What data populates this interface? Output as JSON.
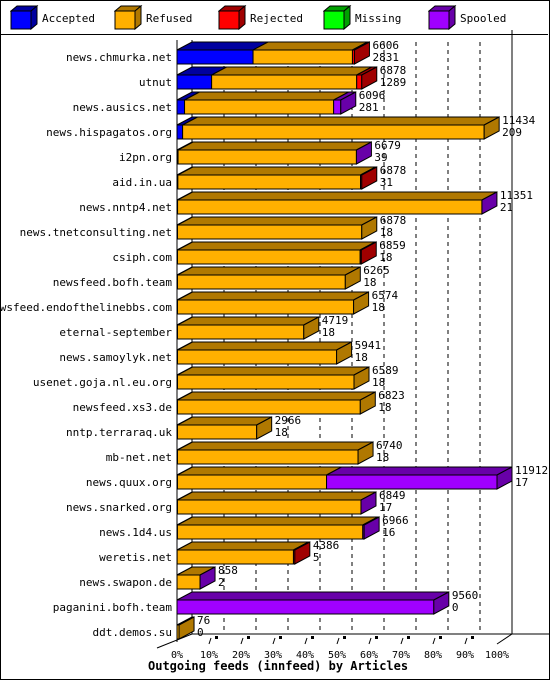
{
  "chart_data": {
    "type": "bar",
    "orientation": "horizontal",
    "stacked": true,
    "title": "Outgoing feeds (innfeed) by Articles",
    "xlabel": "Outgoing feeds (innfeed) by Articles",
    "ylabel": "",
    "x_ticks": [
      "0%",
      "10%",
      "20%",
      "30%",
      "40%",
      "50%",
      "60%",
      "70%",
      "80%",
      "90%",
      "100%"
    ],
    "xlim": [
      0,
      11912
    ],
    "grid": true,
    "legend_position": "top",
    "legend": [
      {
        "name": "Accepted",
        "color": "#0000ff",
        "side": "#0000a0"
      },
      {
        "name": "Refused",
        "color": "#ffb000",
        "side": "#b07800"
      },
      {
        "name": "Rejected",
        "color": "#ff0000",
        "side": "#a00000"
      },
      {
        "name": "Missing",
        "color": "#00ff00",
        "side": "#00a000"
      },
      {
        "name": "Spooled",
        "color": "#a000ff",
        "side": "#6800a8"
      }
    ],
    "categories": [
      "news.chmurka.net",
      "utnut",
      "news.ausics.net",
      "news.hispagatos.org",
      "i2pn.org",
      "aid.in.ua",
      "news.nntp4.net",
      "news.tnetconsulting.net",
      "csiph.com",
      "newsfeed.bofh.team",
      "newsfeed.endofthelinebbs.com",
      "eternal-september",
      "news.samoylyk.net",
      "usenet.goja.nl.eu.org",
      "newsfeed.xs3.de",
      "nntp.terraraq.uk",
      "mb-net.net",
      "news.quux.org",
      "news.snarked.org",
      "news.1d4.us",
      "weretis.net",
      "news.swapon.de",
      "paganini.bofh.team",
      "ddt.demos.su"
    ],
    "totals": [
      6606,
      6878,
      6096,
      11434,
      6679,
      6878,
      11351,
      6878,
      6859,
      6265,
      6574,
      4719,
      5941,
      6589,
      6823,
      2966,
      6740,
      11912,
      6849,
      6966,
      4386,
      858,
      9560,
      76
    ],
    "accepted_labels": [
      2831,
      1289,
      281,
      209,
      39,
      31,
      21,
      18,
      18,
      18,
      18,
      18,
      18,
      18,
      18,
      18,
      18,
      17,
      17,
      16,
      5,
      2,
      0,
      0
    ],
    "series": [
      {
        "name": "Accepted",
        "values": [
          2831,
          1289,
          281,
          209,
          39,
          31,
          21,
          18,
          18,
          18,
          18,
          18,
          18,
          18,
          18,
          18,
          18,
          17,
          17,
          16,
          5,
          2,
          0,
          0
        ]
      },
      {
        "name": "Refused",
        "values": [
          3700,
          5400,
          5550,
          11225,
          6640,
          6800,
          11330,
          6860,
          6800,
          6247,
          6556,
          4701,
          5923,
          6571,
          6805,
          2948,
          6722,
          5550,
          6832,
          6900,
          4330,
          856,
          0,
          76
        ]
      },
      {
        "name": "Rejected",
        "values": [
          75,
          189,
          0,
          0,
          0,
          47,
          0,
          0,
          41,
          0,
          0,
          0,
          0,
          0,
          0,
          0,
          0,
          0,
          0,
          0,
          51,
          0,
          0,
          0
        ]
      },
      {
        "name": "Missing",
        "values": [
          0,
          0,
          0,
          0,
          0,
          0,
          0,
          0,
          0,
          0,
          0,
          0,
          0,
          0,
          0,
          0,
          0,
          0,
          0,
          0,
          0,
          0,
          0,
          0
        ]
      },
      {
        "name": "Spooled",
        "values": [
          0,
          0,
          265,
          0,
          0,
          0,
          0,
          0,
          0,
          0,
          0,
          0,
          0,
          0,
          0,
          0,
          0,
          6345,
          0,
          50,
          0,
          0,
          9560,
          0
        ]
      }
    ],
    "side_color_index": [
      2,
      2,
      4,
      1,
      4,
      2,
      4,
      1,
      2,
      1,
      1,
      1,
      1,
      1,
      1,
      1,
      1,
      4,
      4,
      4,
      2,
      4,
      4,
      1
    ]
  }
}
